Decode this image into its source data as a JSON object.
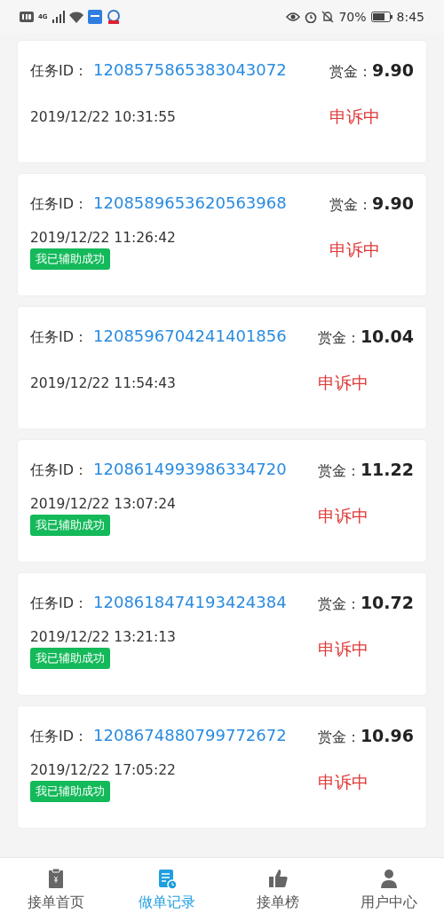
{
  "status_bar": {
    "network": "4G",
    "battery": "70%",
    "time": "8:45"
  },
  "records": [
    {
      "task_label": "任务ID：",
      "task_id": "1208575865383043072",
      "reward_label": "赏金：",
      "reward": "9.90",
      "time": "2019/12/22 10:31:55",
      "status": "申诉中"
    },
    {
      "task_label": "任务ID：",
      "task_id": "1208589653620563968",
      "reward_label": "赏金：",
      "reward": "9.90",
      "time": "2019/12/22 11:26:42",
      "badge": "我已辅助成功",
      "status": "申诉中"
    },
    {
      "task_label": "任务ID：",
      "task_id": "1208596704241401856",
      "reward_label": "赏金：",
      "reward": "10.04",
      "time": "2019/12/22 11:54:43",
      "status": "申诉中"
    },
    {
      "task_label": "任务ID：",
      "task_id": "1208614993986334720",
      "reward_label": "赏金：",
      "reward": "11.22",
      "time": "2019/12/22 13:07:24",
      "badge": "我已辅助成功",
      "status": "申诉中"
    },
    {
      "task_label": "任务ID：",
      "task_id": "1208618474193424384",
      "reward_label": "赏金：",
      "reward": "10.72",
      "time": "2019/12/22 13:21:13",
      "badge": "我已辅助成功",
      "status": "申诉中"
    },
    {
      "task_label": "任务ID：",
      "task_id": "1208674880799772672",
      "reward_label": "赏金：",
      "reward": "10.96",
      "time": "2019/12/22 17:05:22",
      "badge": "我已辅助成功",
      "status": "申诉中"
    }
  ],
  "tabs": [
    {
      "label": "接单首页",
      "selected": false
    },
    {
      "label": "做单记录",
      "selected": true
    },
    {
      "label": "接单榜",
      "selected": false
    },
    {
      "label": "用户中心",
      "selected": false
    }
  ]
}
